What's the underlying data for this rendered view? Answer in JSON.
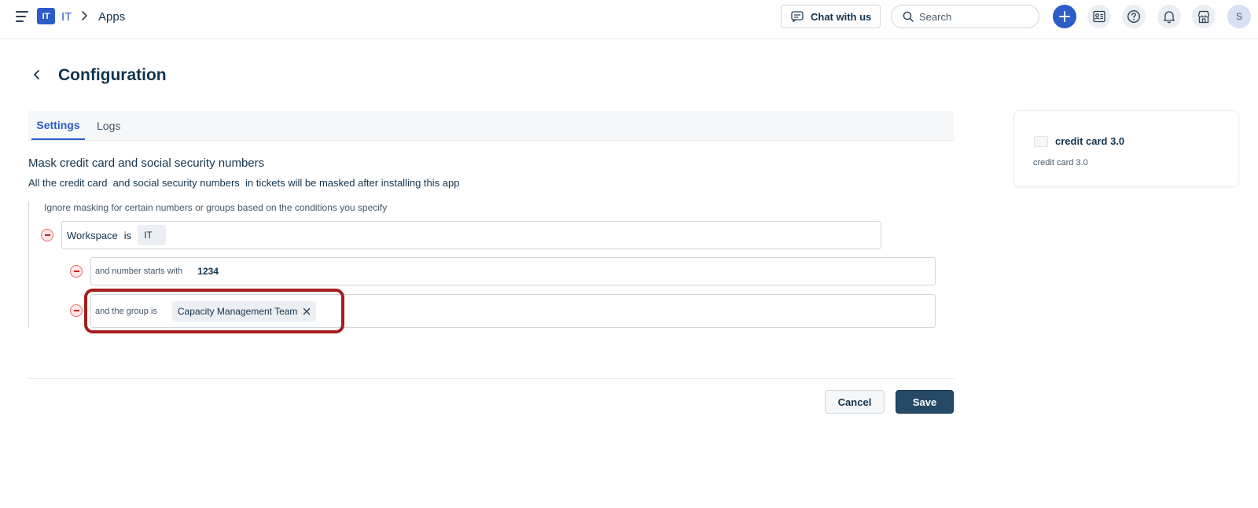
{
  "topbar": {
    "workspace_badge": "IT",
    "workspace_name": "IT",
    "breadcrumb_current": "Apps",
    "chat_label": "Chat with us",
    "search_placeholder": "Search",
    "avatar_initial": "S",
    "icons": [
      "menu-icon",
      "chevron-right-icon",
      "chat-icon",
      "search-icon",
      "plus-icon",
      "contacts-icon",
      "help-icon",
      "bell-icon",
      "marketplace-icon"
    ]
  },
  "page": {
    "title": "Configuration"
  },
  "tabs": [
    {
      "label": "Settings",
      "active": true
    },
    {
      "label": "Logs",
      "active": false
    }
  ],
  "section": {
    "title": "Mask credit card and social security numbers",
    "desc_prefix": "All the ",
    "desc_credit": "credit card",
    "desc_mid": "  and ",
    "desc_ssn": "social security numbers",
    "desc_suffix": "  in tickets will be masked after installing this app",
    "hint": "Ignore masking for certain numbers or groups based on the conditions you specify"
  },
  "conditions": {
    "row1": {
      "field": "Workspace",
      "operator": "is",
      "value": "IT"
    },
    "row2": {
      "label": "and number starts with",
      "value": "1234"
    },
    "row3": {
      "label": "and the group is",
      "chip": "Capacity Management Team"
    }
  },
  "actions": {
    "cancel_label": "Cancel",
    "save_label": "Save"
  },
  "app_card": {
    "name": "credit card 3.0",
    "subtitle": "credit card 3.0"
  },
  "colors": {
    "accent": "#2c5cc5",
    "primary_button": "#264966",
    "highlight": "#a51d1d",
    "remove": "#e86b6b"
  }
}
